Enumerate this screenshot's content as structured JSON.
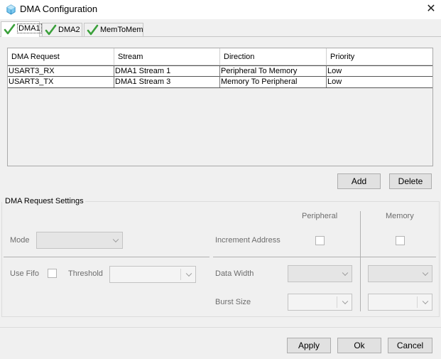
{
  "window": {
    "title": "DMA Configuration",
    "close_label": "✕"
  },
  "tabs": [
    {
      "label": "DMA1"
    },
    {
      "label": "DMA2"
    },
    {
      "label": "MemToMem"
    }
  ],
  "table": {
    "columns": [
      "DMA Request",
      "Stream",
      "Direction",
      "Priority"
    ],
    "rows": [
      [
        "USART3_RX",
        "DMA1 Stream 1",
        "Peripheral To Memory",
        "Low"
      ],
      [
        "USART3_TX",
        "DMA1 Stream 3",
        "Memory To Peripheral",
        "Low"
      ]
    ]
  },
  "table_buttons": {
    "add": "Add",
    "delete": "Delete"
  },
  "settings": {
    "group_title": "DMA Request Settings",
    "peripheral_header": "Peripheral",
    "memory_header": "Memory",
    "mode_label": "Mode",
    "increment_address_label": "Increment Address",
    "use_fifo_label": "Use Fifo",
    "threshold_label": "Threshold",
    "data_width_label": "Data Width",
    "burst_size_label": "Burst Size"
  },
  "footer": {
    "apply": "Apply",
    "ok": "Ok",
    "cancel": "Cancel"
  },
  "colors": {
    "check_green": "#3aa03a",
    "icon_blue": "#3fa9e0"
  }
}
